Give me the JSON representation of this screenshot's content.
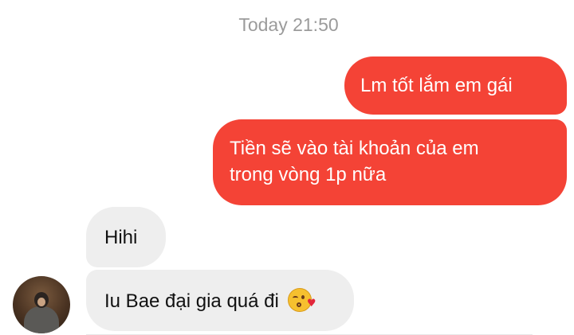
{
  "conversation": {
    "timestamp": "Today 21:50",
    "messages": [
      {
        "direction": "outgoing",
        "text": "Lm tốt lắm em gái"
      },
      {
        "direction": "outgoing",
        "lines": [
          "Tiền sẽ vào tài khoản của em",
          "trong vòng 1p nữa"
        ]
      },
      {
        "direction": "incoming",
        "text": "Hihi"
      },
      {
        "direction": "incoming",
        "text": "Iu Bae đại gia quá đi",
        "emoji": "face-blowing-a-kiss-emoji"
      }
    ]
  },
  "contact": {
    "avatar_icon": "profile-photo-avatar"
  },
  "colors": {
    "outgoing_bubble": "#f44336",
    "incoming_bubble": "#eeeeee",
    "timestamp_text": "#9b9b9b"
  }
}
